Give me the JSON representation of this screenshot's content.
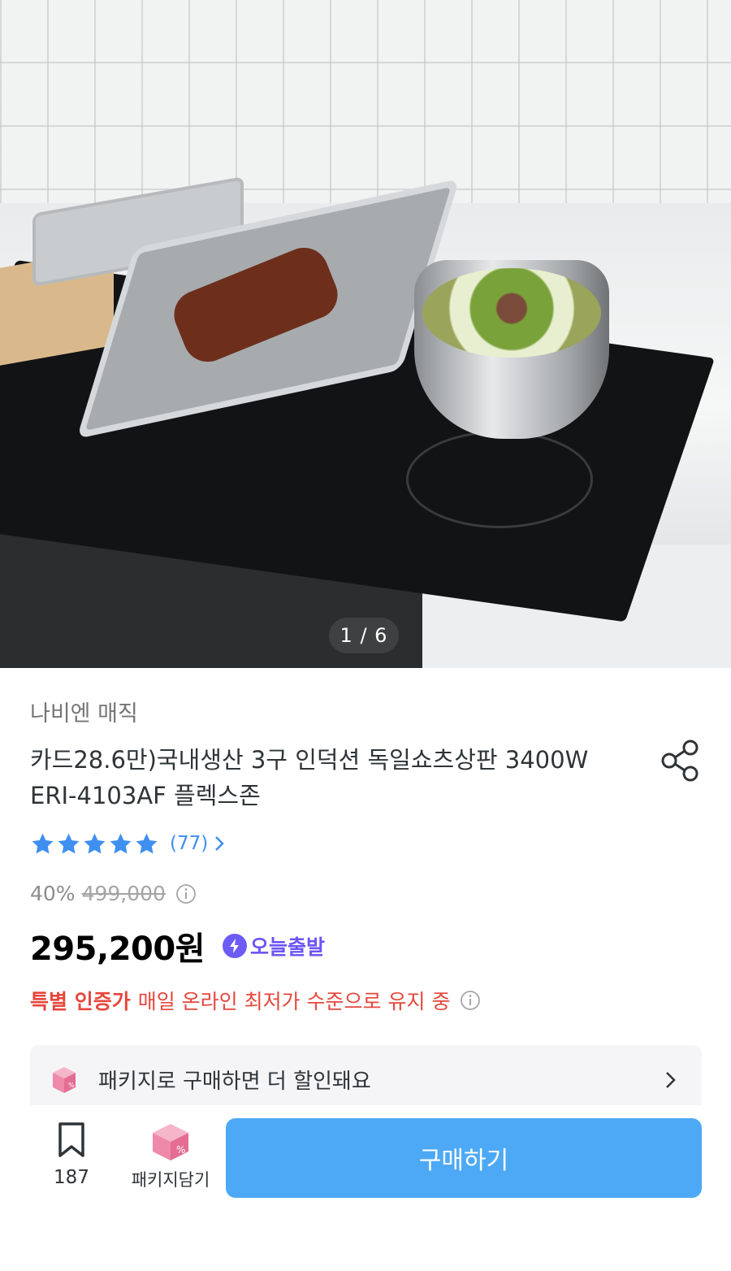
{
  "hero": {
    "image_alt": "product-photo-induction-cooktop",
    "pager": "1 / 6"
  },
  "product": {
    "brand": "나비엔 매직",
    "title": "카드28.6만)국내생산 3구 인덕션 독일쇼츠상판 3400W ERI-4103AF 플렉스존",
    "rating_stars": 5,
    "review_count": "(77)",
    "discount_rate": "40%",
    "original_price": "499,000",
    "price": "295,200원",
    "shipping_badge": "오늘출발",
    "cert_title": "특별 인증가",
    "cert_text": "매일 온라인 최저가 수준으로 유지 중"
  },
  "package_banner": {
    "text": "패키지로 구매하면 더 할인돼요"
  },
  "bottom_bar": {
    "bookmark_count": "187",
    "package_add_label": "패키지담기",
    "buy_label": "구매하기"
  },
  "colors": {
    "star": "#3f8ff1",
    "buy_button": "#4da9f5",
    "shipping_badge": "#6b55f5",
    "cert_red": "#e5473c",
    "package_pink": "#ee89a9"
  }
}
